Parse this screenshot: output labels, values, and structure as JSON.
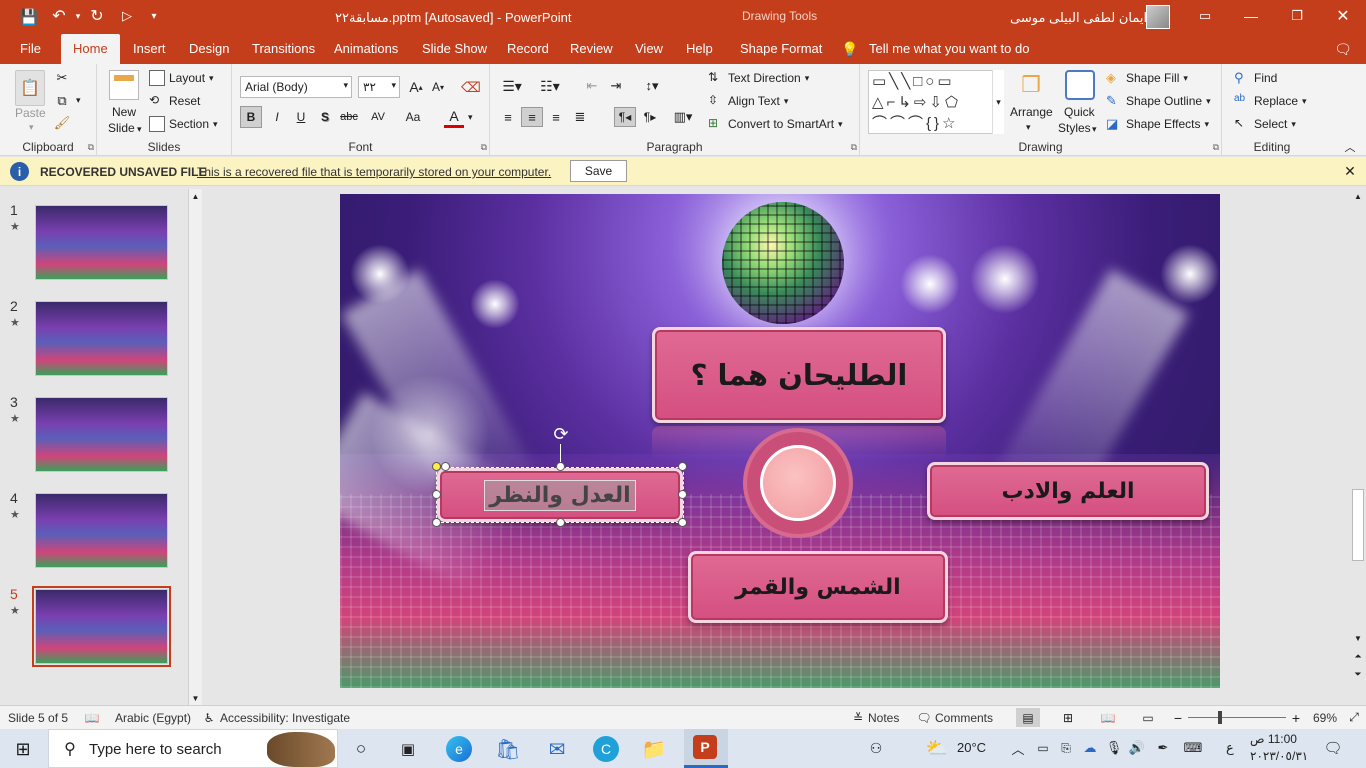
{
  "titlebar": {
    "filename": "مسابقة٢٢.pptm [Autosaved]  -  PowerPoint",
    "tools_label": "Drawing Tools",
    "user_name": "ايمان لطفى البيلى موسى"
  },
  "tabs": [
    "File",
    "Home",
    "Insert",
    "Design",
    "Transitions",
    "Animations",
    "Slide Show",
    "Record",
    "Review",
    "View",
    "Help",
    "Shape Format"
  ],
  "tell_me": "Tell me what you want to do",
  "ribbon": {
    "clipboard": {
      "paste": "Paste",
      "label": "Clipboard"
    },
    "slides": {
      "new_slide_1": "New",
      "new_slide_2": "Slide",
      "layout": "Layout",
      "reset": "Reset",
      "section": "Section",
      "label": "Slides"
    },
    "font": {
      "name": "Arial (Body)",
      "size": "٣٢",
      "bold": "B",
      "italic": "I",
      "underline": "U",
      "shadow": "S",
      "strike": "abc",
      "spacing": "AV",
      "case": "Aa",
      "label": "Font"
    },
    "paragraph": {
      "label": "Paragraph",
      "text_direction": "Text Direction",
      "align_text": "Align Text",
      "smartart": "Convert to SmartArt"
    },
    "drawing": {
      "arrange": "Arrange",
      "quick_styles_1": "Quick",
      "quick_styles_2": "Styles",
      "shape_fill": "Shape Fill",
      "shape_outline": "Shape Outline",
      "shape_effects": "Shape Effects",
      "label": "Drawing"
    },
    "editing": {
      "find": "Find",
      "replace": "Replace",
      "select": "Select",
      "label": "Editing"
    }
  },
  "infobar": {
    "title": "RECOVERED UNSAVED FILE",
    "message": "This is a recovered file that is temporarily stored on your computer.",
    "save": "Save"
  },
  "thumbnails": [
    {
      "num": "1",
      "star": "★"
    },
    {
      "num": "2",
      "star": "★"
    },
    {
      "num": "3",
      "star": "★"
    },
    {
      "num": "4",
      "star": "★"
    },
    {
      "num": "5",
      "star": "★"
    }
  ],
  "slide": {
    "question": "الطليحان هما ؟",
    "answer_left": "العدل والنظر",
    "answer_right": "العلم والادب",
    "answer_bottom": "الشمس والقمر"
  },
  "status": {
    "slide_of": "Slide 5 of 5",
    "language": "Arabic (Egypt)",
    "accessibility": "Accessibility: Investigate",
    "notes": "Notes",
    "comments": "Comments",
    "zoom": "69%"
  },
  "taskbar": {
    "search_placeholder": "Type here to search",
    "temperature": "20°C",
    "time": "11:00 ص",
    "date": "٢٠٢٣/٠٥/٣١",
    "lang": "ع"
  },
  "colors": {
    "accent": "#c43e1c",
    "pink": "#d44f80"
  }
}
